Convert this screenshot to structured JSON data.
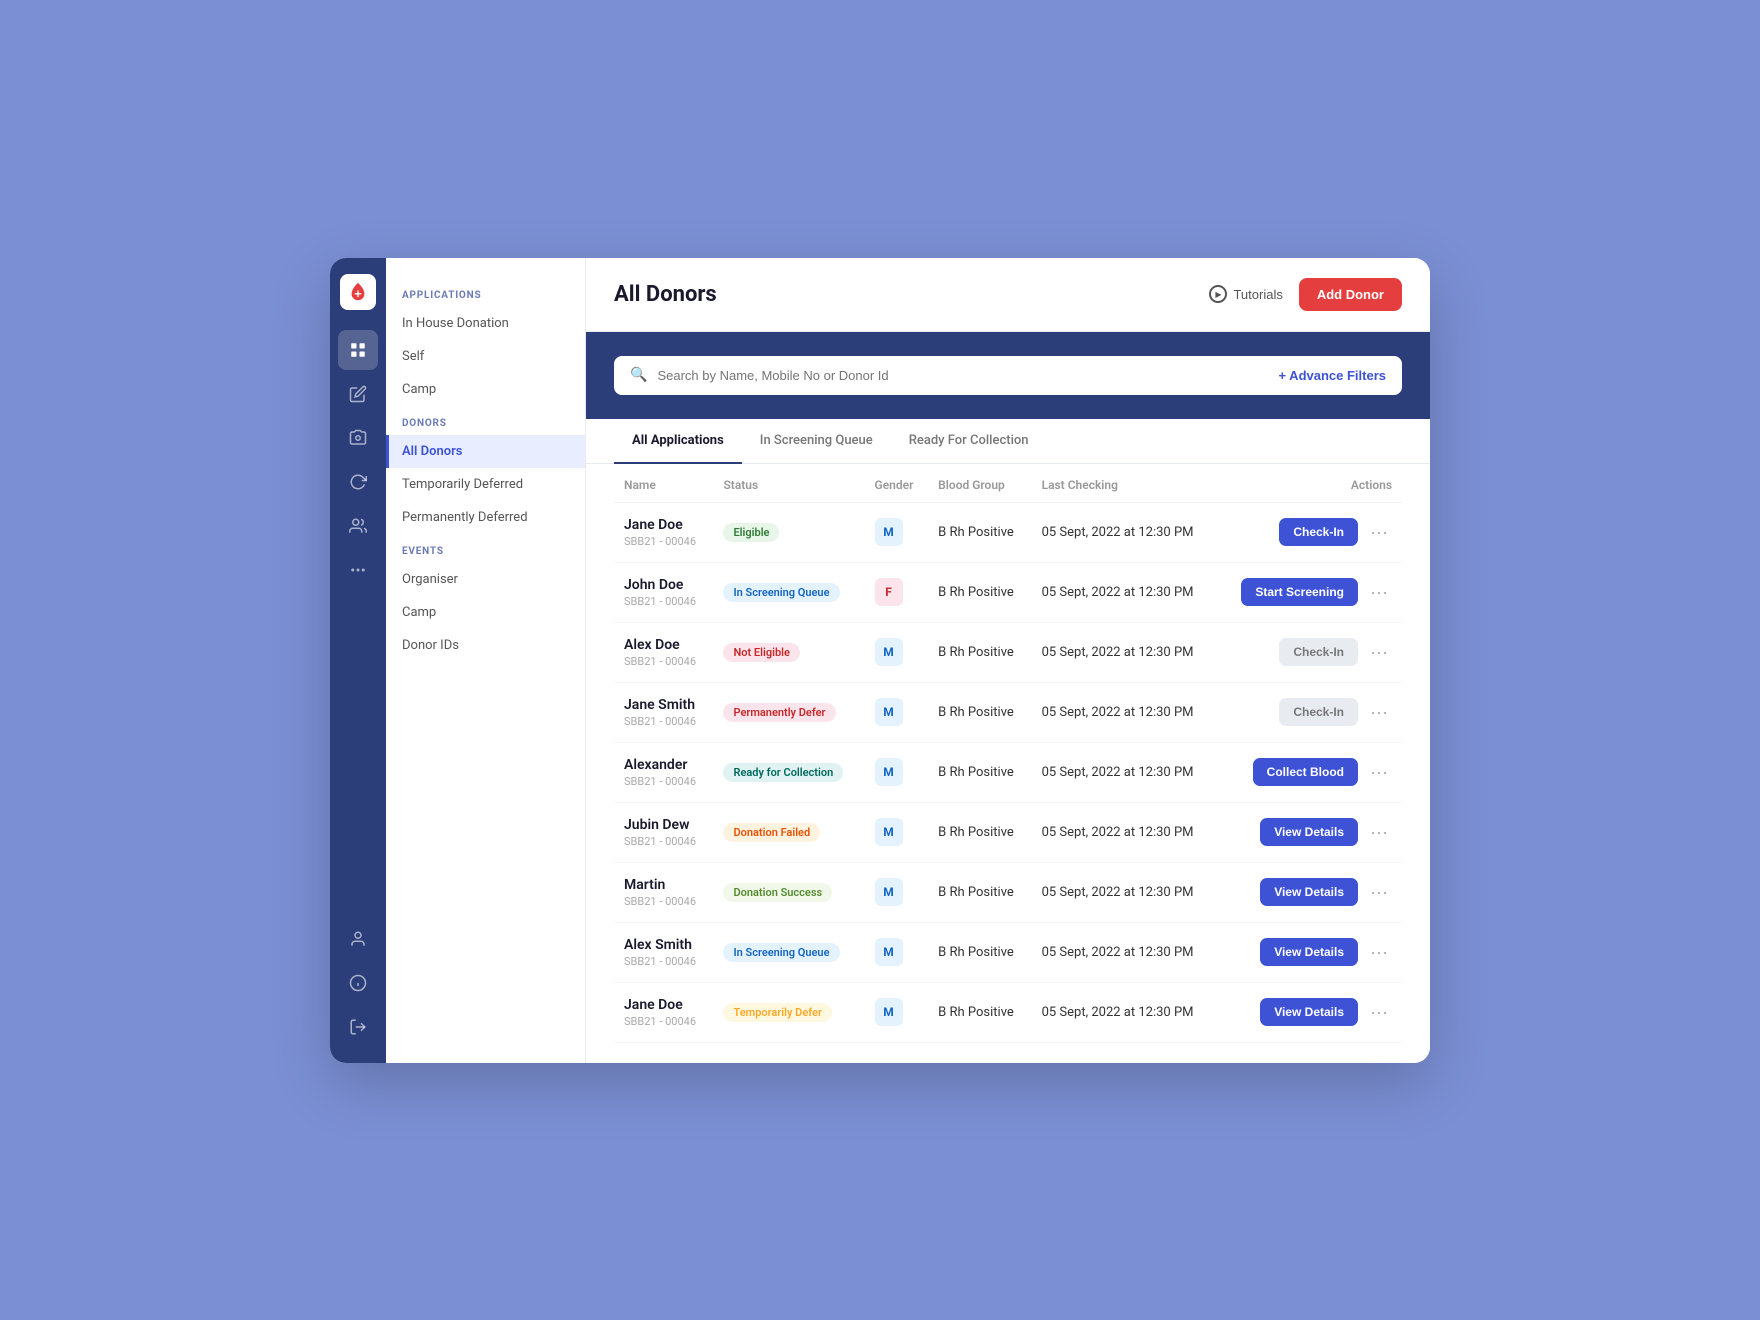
{
  "app": {
    "logo_alt": "Blood Bank Logo"
  },
  "header": {
    "title": "All Donors",
    "tutorials_label": "Tutorials",
    "add_donor_label": "Add Donor"
  },
  "sidebar_icons": [
    {
      "name": "dashboard-icon",
      "symbol": "⊞",
      "active": false
    },
    {
      "name": "edit-icon",
      "symbol": "✏",
      "active": false
    },
    {
      "name": "camera-icon",
      "symbol": "◉",
      "active": false
    },
    {
      "name": "donor-icon",
      "symbol": "↻",
      "active": false
    },
    {
      "name": "people-icon",
      "symbol": "👤",
      "active": false
    },
    {
      "name": "more-icon",
      "symbol": "···",
      "active": false
    }
  ],
  "sidebar_bottom_icons": [
    {
      "name": "profile-icon",
      "symbol": "👤"
    },
    {
      "name": "info-icon",
      "symbol": "ℹ"
    },
    {
      "name": "logout-icon",
      "symbol": "⎋"
    }
  ],
  "left_nav": {
    "applications_label": "APPLICATIONS",
    "applications_items": [
      {
        "label": "In House Donation",
        "active": false
      },
      {
        "label": "Self",
        "active": false
      },
      {
        "label": "Camp",
        "active": false
      }
    ],
    "donors_label": "DONORS",
    "donors_items": [
      {
        "label": "All Donors",
        "active": true
      },
      {
        "label": "Temporarily Deferred",
        "active": false
      },
      {
        "label": "Permanently Deferred",
        "active": false
      }
    ],
    "events_label": "EVENTS",
    "events_items": [
      {
        "label": "Organiser",
        "active": false
      },
      {
        "label": "Camp",
        "active": false
      },
      {
        "label": "Donor IDs",
        "active": false
      }
    ]
  },
  "search": {
    "placeholder": "Search by Name, Mobile No or Donor Id",
    "advance_filters_label": "+ Advance Filters"
  },
  "tabs": [
    {
      "label": "All Applications",
      "active": true
    },
    {
      "label": "In Screening Queue",
      "active": false
    },
    {
      "label": "Ready For Collection",
      "active": false
    }
  ],
  "table": {
    "columns": [
      "Name",
      "Status",
      "Gender",
      "Blood Group",
      "Last Checking",
      "Actions"
    ],
    "rows": [
      {
        "name": "Jane Doe",
        "id": "SBB21 - 00046",
        "status": "Eligible",
        "status_class": "badge-eligible",
        "gender": "M",
        "gender_class": "gender-m",
        "blood_group": "B Rh Positive",
        "last_checking": "05 Sept, 2022 at 12:30 PM",
        "action_label": "Check-In",
        "action_class": "btn-blue"
      },
      {
        "name": "John Doe",
        "id": "SBB21 - 00046",
        "status": "In Screening Queue",
        "status_class": "badge-screening",
        "gender": "F",
        "gender_class": "gender-f",
        "blood_group": "B Rh Positive",
        "last_checking": "05 Sept, 2022 at 12:30 PM",
        "action_label": "Start Screening",
        "action_class": "btn-blue"
      },
      {
        "name": "Alex Doe",
        "id": "SBB21 - 00046",
        "status": "Not Eligible",
        "status_class": "badge-not-eligible",
        "gender": "M",
        "gender_class": "gender-m",
        "blood_group": "B Rh Positive",
        "last_checking": "05 Sept, 2022 at 12:30 PM",
        "action_label": "Check-In",
        "action_class": "btn-gray"
      },
      {
        "name": "Jane Smith",
        "id": "SBB21 - 00046",
        "status": "Permanently Defer",
        "status_class": "badge-perm-defer",
        "gender": "M",
        "gender_class": "gender-m",
        "blood_group": "B Rh Positive",
        "last_checking": "05 Sept, 2022 at 12:30 PM",
        "action_label": "Check-In",
        "action_class": "btn-gray"
      },
      {
        "name": "Alexander",
        "id": "SBB21 - 00046",
        "status": "Ready for Collection",
        "status_class": "badge-ready",
        "gender": "M",
        "gender_class": "gender-m",
        "blood_group": "B Rh Positive",
        "last_checking": "05 Sept, 2022 at 12:30 PM",
        "action_label": "Collect Blood",
        "action_class": "btn-blue"
      },
      {
        "name": "Jubin Dew",
        "id": "SBB21 - 00046",
        "status": "Donation Failed",
        "status_class": "badge-failed",
        "gender": "M",
        "gender_class": "gender-m",
        "blood_group": "B Rh Positive",
        "last_checking": "05 Sept, 2022 at 12:30 PM",
        "action_label": "View Details",
        "action_class": "btn-blue"
      },
      {
        "name": "Martin",
        "id": "SBB21 - 00046",
        "status": "Donation Success",
        "status_class": "badge-success",
        "gender": "M",
        "gender_class": "gender-m",
        "blood_group": "B Rh Positive",
        "last_checking": "05 Sept, 2022 at 12:30 PM",
        "action_label": "View Details",
        "action_class": "btn-blue"
      },
      {
        "name": "Alex Smith",
        "id": "SBB21 - 00046",
        "status": "In Screening Queue",
        "status_class": "badge-screening",
        "gender": "M",
        "gender_class": "gender-m",
        "blood_group": "B Rh Positive",
        "last_checking": "05 Sept, 2022 at 12:30 PM",
        "action_label": "View Details",
        "action_class": "btn-blue"
      },
      {
        "name": "Jane Doe",
        "id": "SBB21 - 00046",
        "status": "Temporarily Defer",
        "status_class": "badge-temp-defer",
        "gender": "M",
        "gender_class": "gender-m",
        "blood_group": "B Rh Positive",
        "last_checking": "05 Sept, 2022 at 12:30 PM",
        "action_label": "View Details",
        "action_class": "btn-blue"
      }
    ]
  }
}
